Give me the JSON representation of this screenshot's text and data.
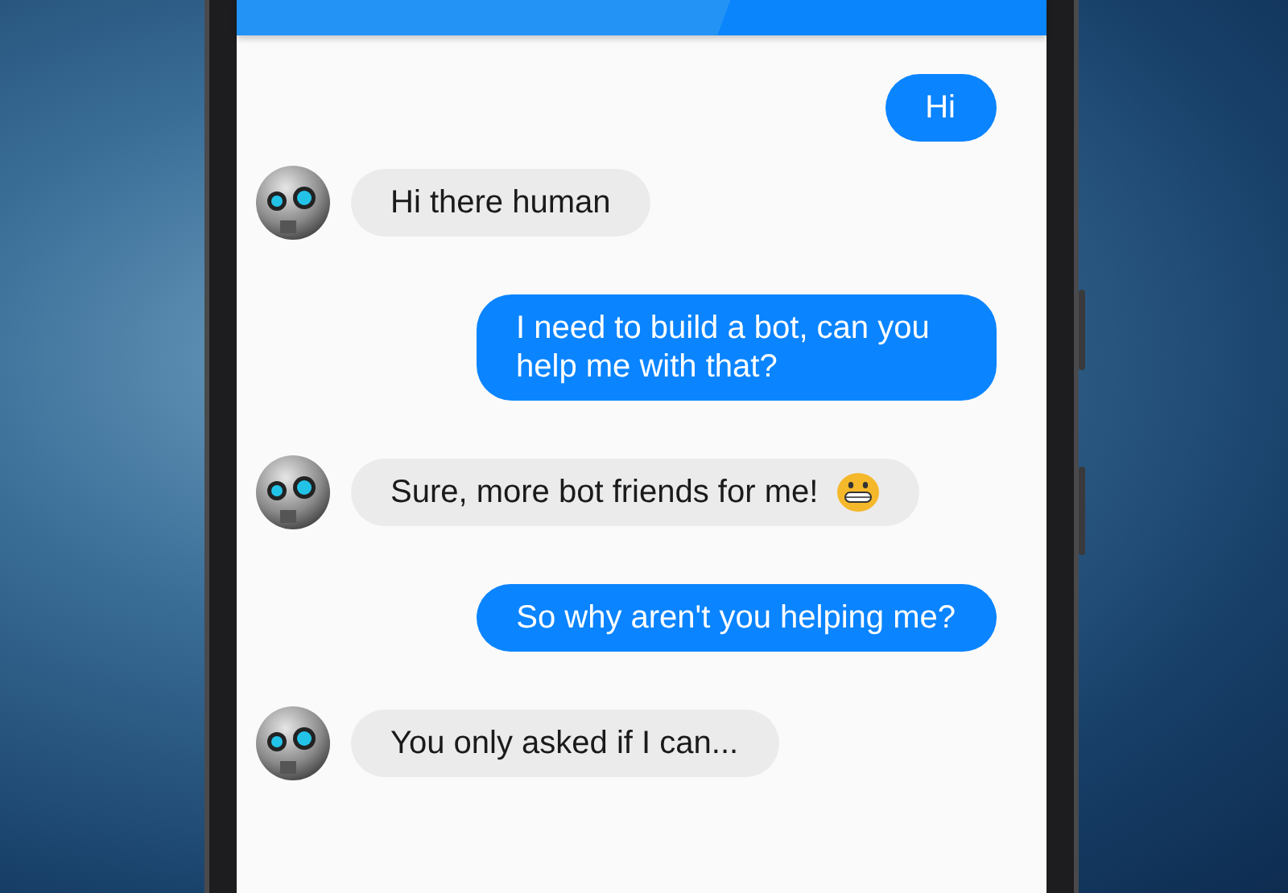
{
  "messages": [
    {
      "kind": "user",
      "text": "Hi"
    },
    {
      "kind": "bot",
      "text": "Hi there human"
    },
    {
      "kind": "user",
      "text": "I need to build a bot, can you help me with that?"
    },
    {
      "kind": "bot",
      "text": "Sure, more bot friends for me!",
      "emoji": true
    },
    {
      "kind": "user",
      "text": "So why aren't you helping me?"
    },
    {
      "kind": "bot",
      "text": "You only asked if I can..."
    }
  ]
}
